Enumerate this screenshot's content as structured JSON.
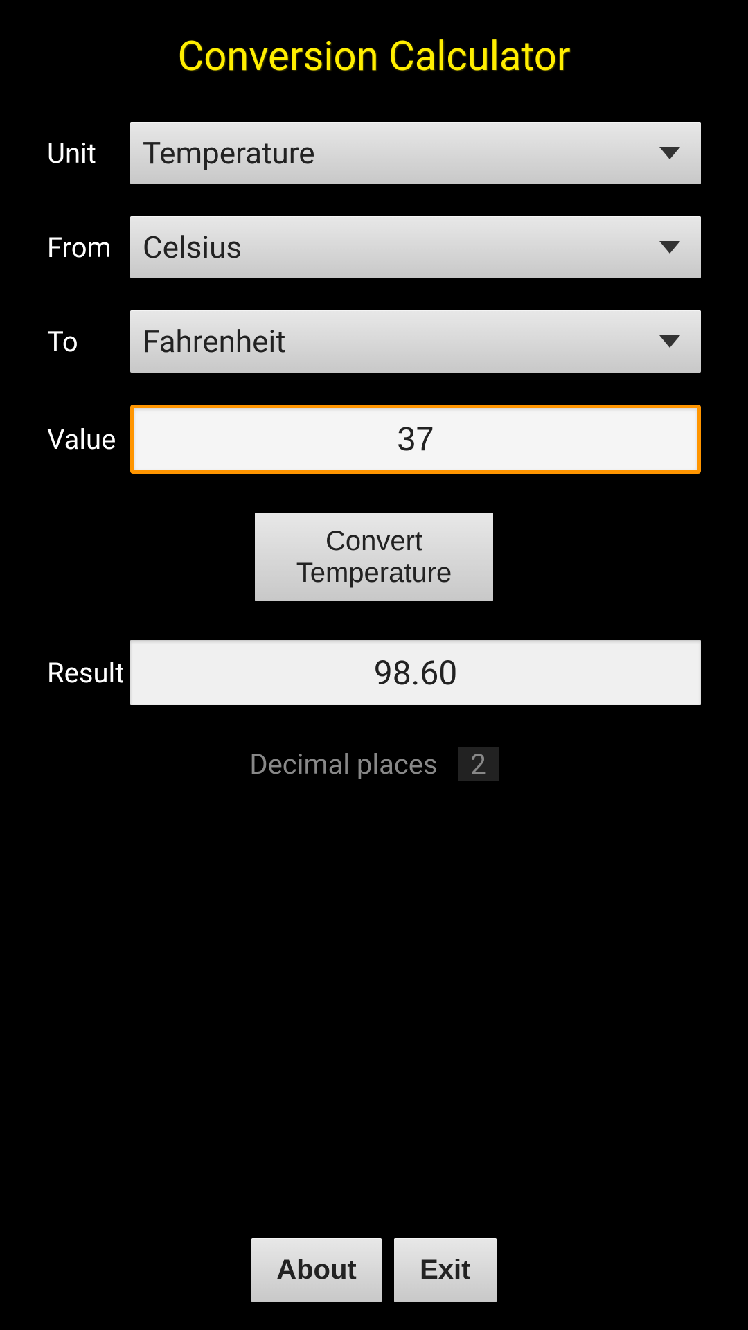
{
  "title": "Conversion Calculator",
  "form": {
    "unit": {
      "label": "Unit",
      "selected": "Temperature"
    },
    "from": {
      "label": "From",
      "selected": "Celsius"
    },
    "to": {
      "label": "To",
      "selected": "Fahrenheit"
    },
    "value": {
      "label": "Value",
      "input": "37"
    },
    "convert_button": "Convert\nTemperature",
    "result": {
      "label": "Result",
      "value": "98.60"
    },
    "decimal": {
      "label": "Decimal places",
      "value": "2"
    }
  },
  "buttons": {
    "about": "About",
    "exit": "Exit"
  }
}
